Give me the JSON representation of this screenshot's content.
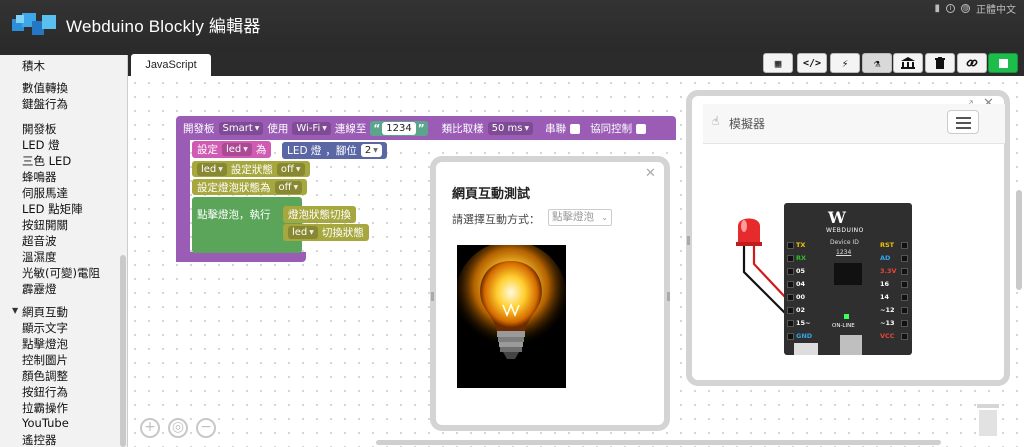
{
  "app": {
    "title": "Webduino Blockly 編輯器",
    "language": "正體中文",
    "top_icons": [
      "bookmark-icon",
      "info-icon",
      "globe-icon"
    ]
  },
  "tabs": [
    {
      "label": "JavaScript",
      "active": true
    }
  ],
  "toolbar": {
    "buttons": [
      {
        "name": "qrcode-button",
        "icon": "qrcode-icon",
        "glyph": "▦"
      },
      {
        "name": "code-button",
        "icon": "code-icon",
        "glyph": "</>"
      },
      {
        "name": "flash-button",
        "icon": "lightning-icon",
        "glyph": "⚡"
      },
      {
        "name": "lab-button",
        "icon": "flask-icon",
        "glyph": "⚗"
      },
      {
        "name": "museum-button",
        "icon": "bank-icon",
        "glyph": "🏛"
      },
      {
        "name": "delete-button",
        "icon": "trash-icon",
        "glyph": "🗑"
      },
      {
        "name": "link-button",
        "icon": "link-icon",
        "glyph": "🔗"
      },
      {
        "name": "run-button",
        "icon": "stop-square-icon",
        "glyph": "■"
      }
    ]
  },
  "sidebar": {
    "items": [
      {
        "label": "積木",
        "y": 0
      },
      {
        "label": "數值轉換",
        "y": 0
      },
      {
        "label": "鍵盤行為",
        "y": 0
      },
      {
        "label": "開發板",
        "y": 0
      },
      {
        "label": "LED 燈",
        "y": 0
      },
      {
        "label": "三色 LED",
        "y": 0
      },
      {
        "label": "蜂鳴器",
        "y": 0
      },
      {
        "label": "伺服馬達",
        "y": 0
      },
      {
        "label": "LED 點矩陣",
        "y": 0
      },
      {
        "label": "按鈕開關",
        "y": 0
      },
      {
        "label": "超音波",
        "y": 0
      },
      {
        "label": "溫濕度",
        "y": 0
      },
      {
        "label": "光敏(可變)電阻",
        "y": 0
      },
      {
        "label": "霹靂燈",
        "y": 0
      },
      {
        "label": "網頁互動",
        "y": 0,
        "expanded": true
      },
      {
        "label": "顯示文字",
        "y": 0
      },
      {
        "label": "點擊燈泡",
        "y": 0
      },
      {
        "label": "控制圖片",
        "y": 0
      },
      {
        "label": "顏色調整",
        "y": 0
      },
      {
        "label": "按鈕行為",
        "y": 0
      },
      {
        "label": "拉霸操作",
        "y": 0
      },
      {
        "label": "YouTube",
        "y": 0
      },
      {
        "label": "遙控器",
        "y": 0
      }
    ]
  },
  "blocks": {
    "board": {
      "prefix": "開發板",
      "type": "Smart",
      "use": "使用",
      "conn": "Wi-Fi",
      "connect_to": "連線至",
      "device_id": "1234",
      "sampling_label": "類比取樣",
      "sampling": "50 ms",
      "serial": "串聯",
      "collab": "協同控制"
    },
    "set_led": {
      "label": "設定",
      "var": "led",
      "as": "為",
      "led_label": "LED 燈",
      "pin_label": "，腳位",
      "pin": "2"
    },
    "led_state": {
      "var": "led",
      "label": "設定狀態",
      "value": "off"
    },
    "bulb_state": {
      "label": "設定燈泡狀態為",
      "value": "off"
    },
    "click_bulb": {
      "label": "點擊燈泡，執行"
    },
    "toggle_bulb": {
      "label": "燈泡狀態切換"
    },
    "toggle_led": {
      "var": "led",
      "label": "切換狀態"
    }
  },
  "web_window": {
    "title": "網頁互動測試",
    "mode_label": "請選擇互動方式：",
    "mode_value": "點擊燈泡",
    "close": "✕"
  },
  "simulator": {
    "title": "模擬器",
    "expand": "⤢",
    "close": "✕",
    "board_brand": "WEBDUINO",
    "device_label": "Device ID",
    "device_id": "1234",
    "online_label": "ON-LINE",
    "left_pins": [
      "TX",
      "RX",
      "05",
      "04",
      "00",
      "02",
      "15~",
      "GND"
    ],
    "right_pins": [
      "RST",
      "AD",
      "3.3V",
      "16",
      "14",
      "~12",
      "~13",
      "VCC"
    ],
    "left_colors": [
      "#f2c300",
      "#2fbd2f",
      "#ffffff",
      "#ffffff",
      "#ffffff",
      "#ffffff",
      "#ffffff",
      "#35a3e6"
    ],
    "right_colors": [
      "#f2c300",
      "#35a3e6",
      "#e8463a",
      "#ffffff",
      "#ffffff",
      "#ffffff",
      "#ffffff",
      "#e8463a"
    ]
  },
  "zoom": {
    "plus": "+",
    "reset": "◎",
    "minus": "−"
  },
  "colors": {
    "board_block": "#9a5cb5",
    "led_block": "#cf5bb2",
    "pin_block": "#5b67a5",
    "state_block": "#a6a73f",
    "event_block": "#5ba55b",
    "run_button": "#1ebd4b"
  }
}
